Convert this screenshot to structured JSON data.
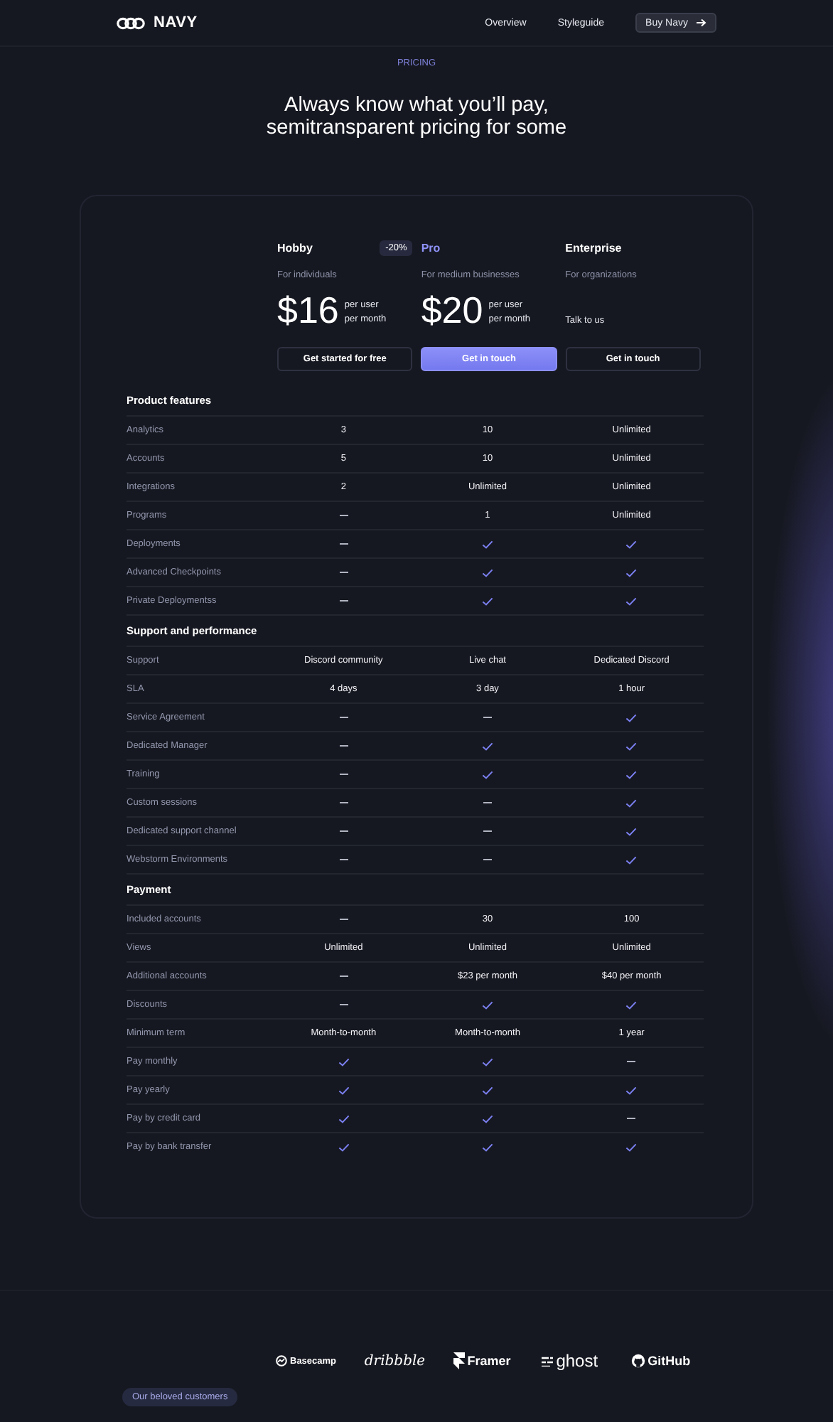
{
  "nav": {
    "logo": "NAVY",
    "links": [
      {
        "label": "Overview"
      },
      {
        "label": "Styleguide"
      }
    ],
    "cta": "Buy Navy"
  },
  "hero": {
    "eyebrow": "PRICING",
    "title_lines": [
      "Always know what you’ll pay,",
      "semitransparent pricing for some"
    ]
  },
  "plans": [
    {
      "name": "Hobby",
      "badge": "-20%",
      "highlighted": false,
      "subtitle": "For individuals",
      "price": "$16",
      "unit_lines": [
        "per user",
        "per month"
      ],
      "button": "Get started for free"
    },
    {
      "name": "Pro",
      "highlighted": true,
      "subtitle": "For medium businesses",
      "price": "$20",
      "unit_lines": [
        "per user",
        "per month"
      ],
      "button": "Get in touch"
    },
    {
      "name": "Enterprise",
      "highlighted": false,
      "subtitle": "For organizations",
      "contact": "Talk to us",
      "button": "Get in touch"
    }
  ],
  "sections": [
    {
      "title": "Product features",
      "rows": [
        {
          "label": "Analytics",
          "cells": [
            {
              "kind": "text",
              "text": "3"
            },
            {
              "kind": "text",
              "text": "10"
            },
            {
              "kind": "text",
              "text": "Unlimited"
            }
          ]
        },
        {
          "label": "Accounts",
          "cells": [
            {
              "kind": "text",
              "text": "5"
            },
            {
              "kind": "text",
              "text": "10"
            },
            {
              "kind": "text",
              "text": "Unlimited"
            }
          ]
        },
        {
          "label": "Integrations",
          "cells": [
            {
              "kind": "text",
              "text": "2"
            },
            {
              "kind": "text",
              "text": "Unlimited"
            },
            {
              "kind": "text",
              "text": "Unlimited"
            }
          ]
        },
        {
          "label": "Programs",
          "cells": [
            {
              "kind": "dash"
            },
            {
              "kind": "text",
              "text": "1"
            },
            {
              "kind": "text",
              "text": "Unlimited"
            }
          ]
        },
        {
          "label": "Deployments",
          "cells": [
            {
              "kind": "dash"
            },
            {
              "kind": "check"
            },
            {
              "kind": "check"
            }
          ]
        },
        {
          "label": "Advanced Checkpoints",
          "cells": [
            {
              "kind": "dash"
            },
            {
              "kind": "check"
            },
            {
              "kind": "check"
            }
          ]
        },
        {
          "label": "Private Deploymentss",
          "cells": [
            {
              "kind": "dash"
            },
            {
              "kind": "check"
            },
            {
              "kind": "check"
            }
          ]
        }
      ]
    },
    {
      "title": "Support and performance",
      "rows": [
        {
          "label": "Support",
          "cells": [
            {
              "kind": "text",
              "text": "Discord community"
            },
            {
              "kind": "text",
              "text": "Live chat"
            },
            {
              "kind": "text",
              "text": "Dedicated Discord"
            }
          ]
        },
        {
          "label": "SLA",
          "cells": [
            {
              "kind": "text",
              "text": "4 days"
            },
            {
              "kind": "text",
              "text": "3 day"
            },
            {
              "kind": "text",
              "text": "1 hour"
            }
          ]
        },
        {
          "label": "Service Agreement",
          "cells": [
            {
              "kind": "dash"
            },
            {
              "kind": "dash"
            },
            {
              "kind": "check"
            }
          ]
        },
        {
          "label": "Dedicated Manager",
          "cells": [
            {
              "kind": "dash"
            },
            {
              "kind": "check"
            },
            {
              "kind": "check"
            }
          ]
        },
        {
          "label": "Training",
          "cells": [
            {
              "kind": "dash"
            },
            {
              "kind": "check"
            },
            {
              "kind": "check"
            }
          ]
        },
        {
          "label": "Custom sessions",
          "cells": [
            {
              "kind": "dash"
            },
            {
              "kind": "dash"
            },
            {
              "kind": "check"
            }
          ]
        },
        {
          "label": "Dedicated support channel",
          "cells": [
            {
              "kind": "dash"
            },
            {
              "kind": "dash"
            },
            {
              "kind": "check"
            }
          ]
        },
        {
          "label": "Webstorm Environments",
          "cells": [
            {
              "kind": "dash"
            },
            {
              "kind": "dash"
            },
            {
              "kind": "check"
            }
          ]
        }
      ]
    },
    {
      "title": "Payment",
      "rows": [
        {
          "label": "Included accounts",
          "cells": [
            {
              "kind": "dash"
            },
            {
              "kind": "text",
              "text": "30"
            },
            {
              "kind": "text",
              "text": "100"
            }
          ]
        },
        {
          "label": "Views",
          "cells": [
            {
              "kind": "text",
              "text": "Unlimited"
            },
            {
              "kind": "text",
              "text": "Unlimited"
            },
            {
              "kind": "text",
              "text": "Unlimited"
            }
          ]
        },
        {
          "label": "Additional accounts",
          "cells": [
            {
              "kind": "dash"
            },
            {
              "kind": "text",
              "text": "$23 per month"
            },
            {
              "kind": "text",
              "text": "$40 per month"
            }
          ]
        },
        {
          "label": "Discounts",
          "cells": [
            {
              "kind": "dash"
            },
            {
              "kind": "check"
            },
            {
              "kind": "check"
            }
          ]
        },
        {
          "label": "Minimum term",
          "cells": [
            {
              "kind": "text",
              "text": "Month-to-month"
            },
            {
              "kind": "text",
              "text": "Month-to-month"
            },
            {
              "kind": "text",
              "text": "1 year"
            }
          ]
        },
        {
          "label": "Pay monthly",
          "cells": [
            {
              "kind": "check"
            },
            {
              "kind": "check"
            },
            {
              "kind": "dash"
            }
          ]
        },
        {
          "label": "Pay yearly",
          "cells": [
            {
              "kind": "check"
            },
            {
              "kind": "check"
            },
            {
              "kind": "check"
            }
          ]
        },
        {
          "label": "Pay by credit card",
          "cells": [
            {
              "kind": "check"
            },
            {
              "kind": "check"
            },
            {
              "kind": "dash"
            }
          ]
        },
        {
          "label": "Pay by bank transfer",
          "cells": [
            {
              "kind": "check"
            },
            {
              "kind": "check"
            },
            {
              "kind": "check"
            }
          ]
        }
      ]
    }
  ],
  "customers": {
    "label": "Our beloved customers",
    "logos": [
      {
        "kind": "basecamp",
        "text": "Basecamp"
      },
      {
        "kind": "script",
        "text": "dribbble"
      },
      {
        "kind": "framer",
        "text": "Framer"
      },
      {
        "kind": "ghost",
        "text": "ghost"
      },
      {
        "kind": "github",
        "text": "GitHub"
      }
    ]
  }
}
